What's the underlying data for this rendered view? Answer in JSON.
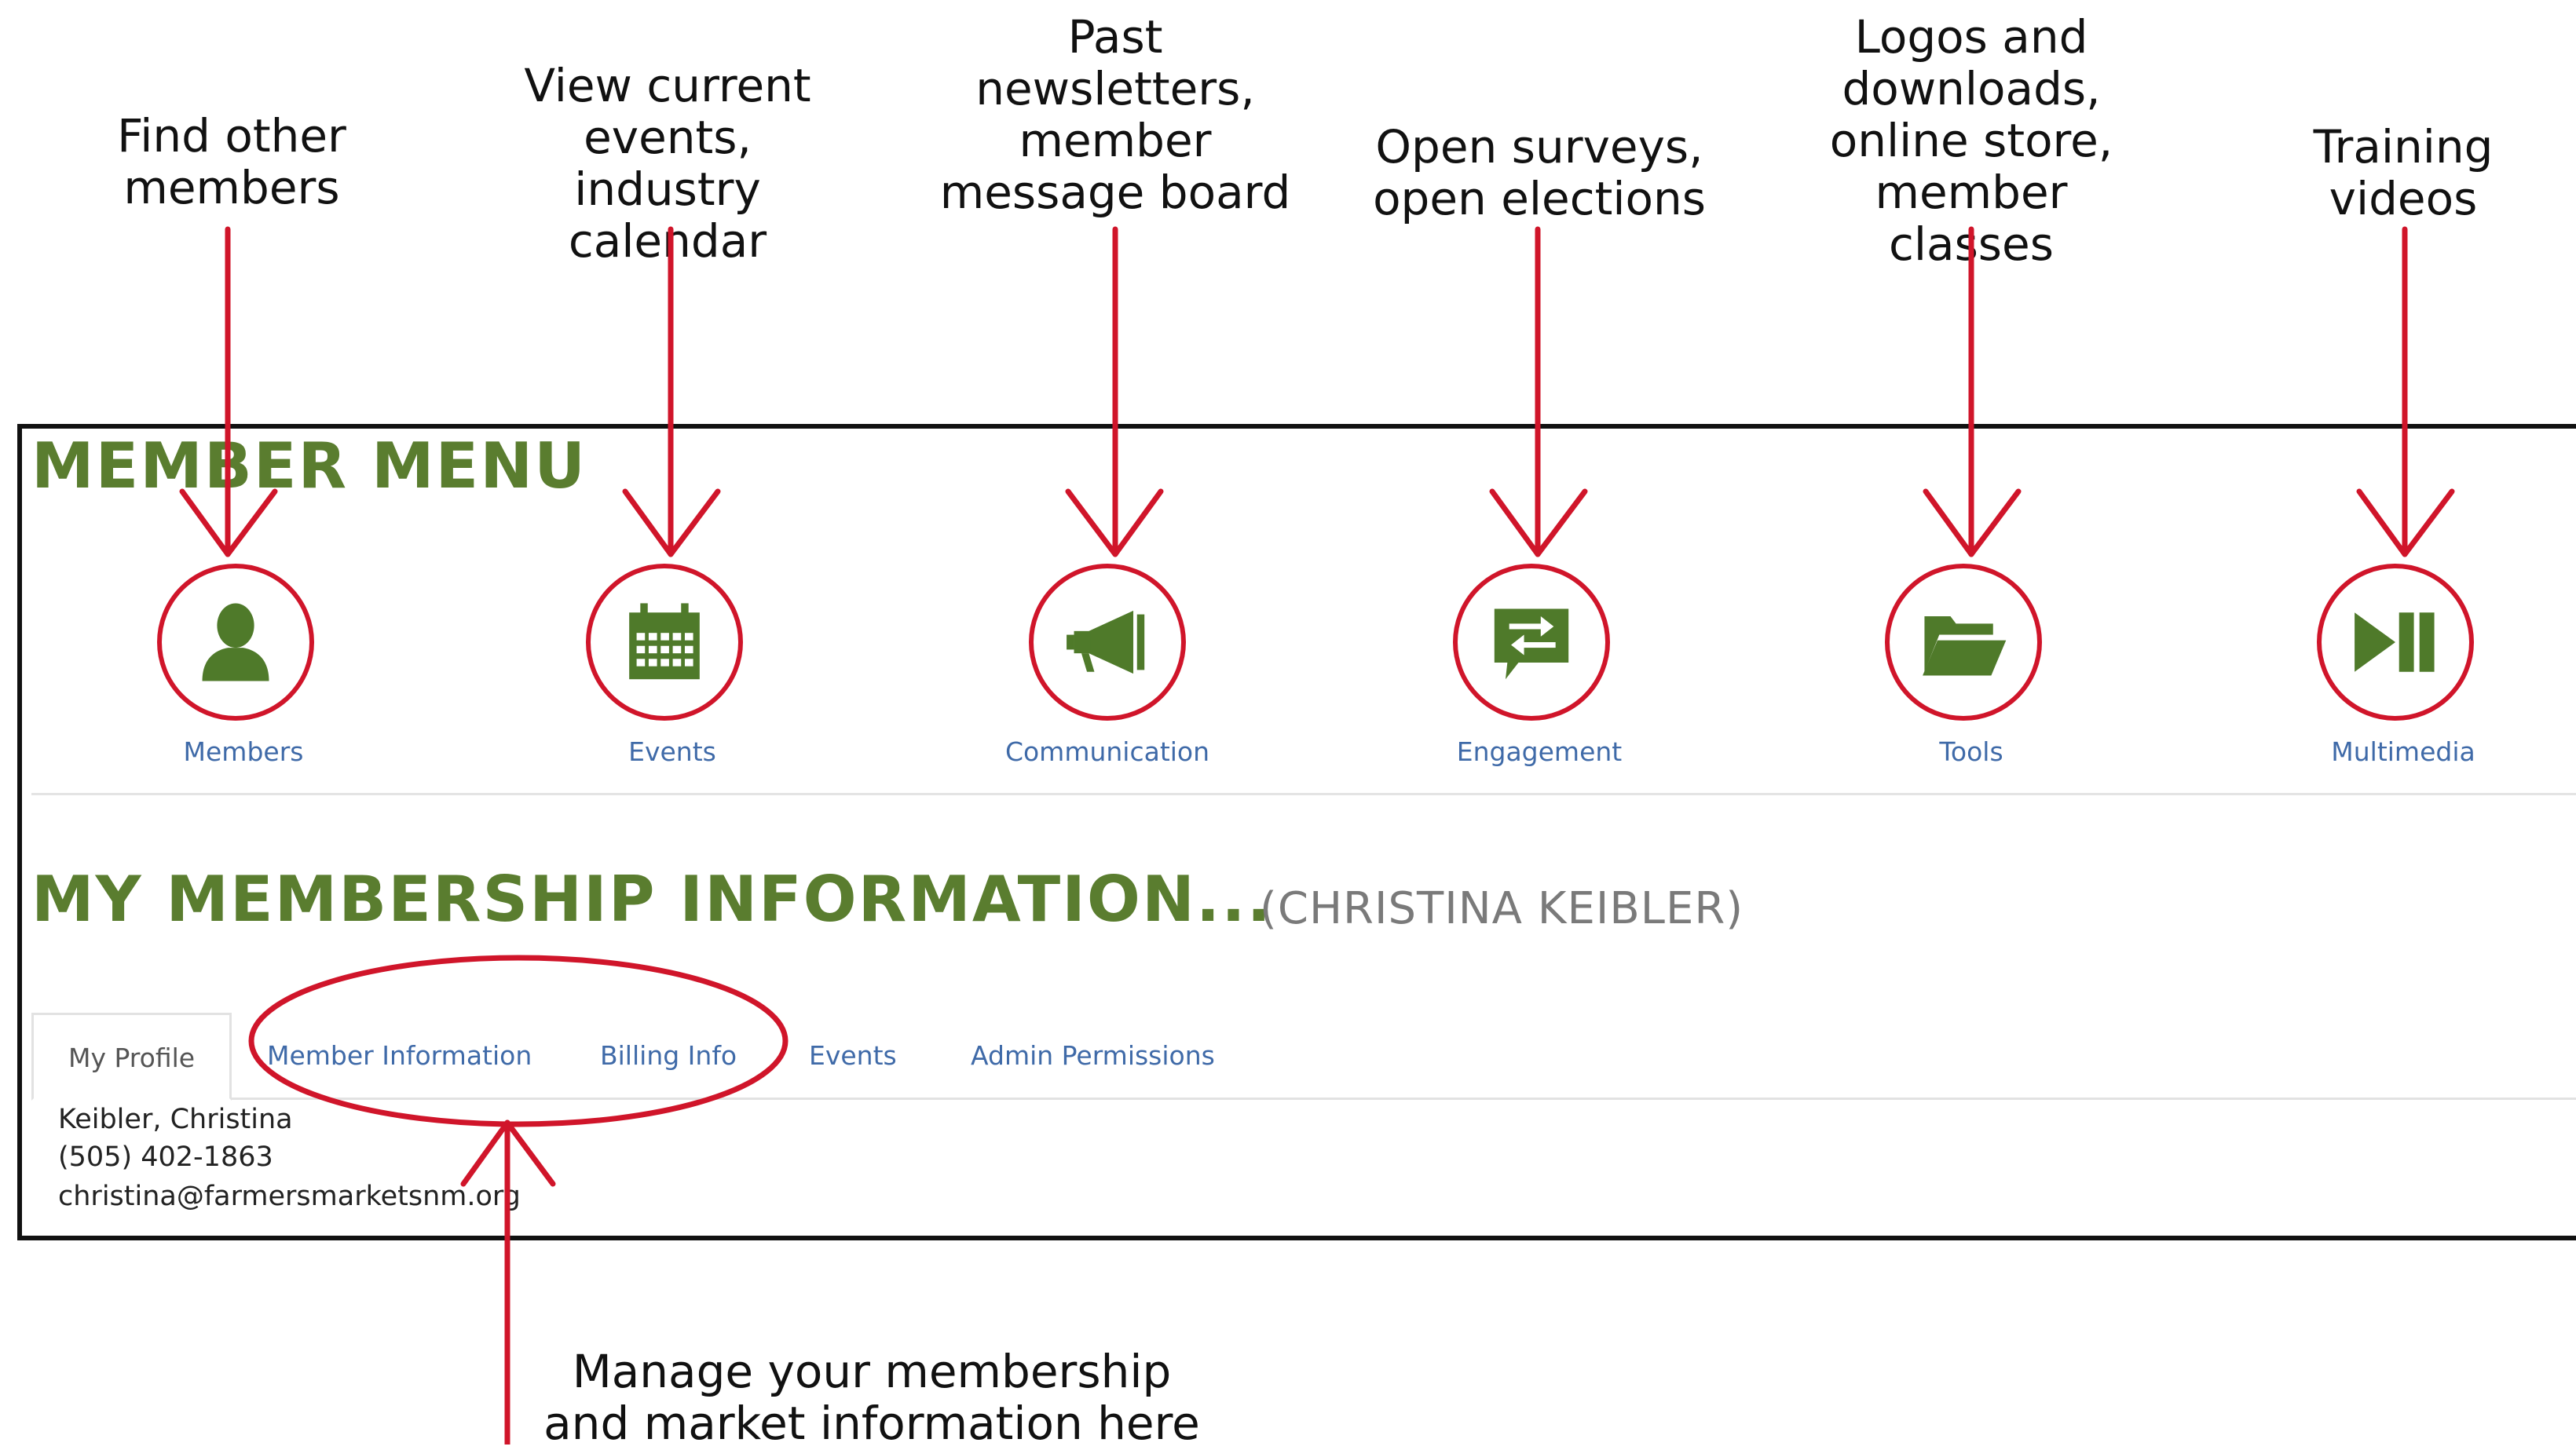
{
  "annotations": {
    "members": "Find other\nmembers",
    "events": "View current\nevents,\nindustry\ncalendar",
    "communication": "Past\nnewsletters,\nmember\nmessage board",
    "engagement": "Open surveys,\nopen elections",
    "tools": "Logos and\ndownloads,\nonline store,\nmember\nclasses",
    "multimedia": "Training\nvideos",
    "manage": "Manage your membership\nand market information  here"
  },
  "member_menu": {
    "title": "MEMBER MENU",
    "items": [
      {
        "label": "Members",
        "icon": "person-icon"
      },
      {
        "label": "Events",
        "icon": "calendar-icon"
      },
      {
        "label": "Communication",
        "icon": "megaphone-icon"
      },
      {
        "label": "Engagement",
        "icon": "exchange-chat-icon"
      },
      {
        "label": "Tools",
        "icon": "open-folder-icon"
      },
      {
        "label": "Multimedia",
        "icon": "play-pause-icon"
      }
    ]
  },
  "membership": {
    "title": "MY MEMBERSHIP INFORMATION...",
    "user": "(CHRISTINA KEIBLER)",
    "tabs": [
      "My Profile",
      "Member Information",
      "Billing Info",
      "Events",
      "Admin Permissions"
    ],
    "profile": {
      "name": "Keibler, Christina",
      "phone": "(505) 402-1863",
      "email": "christina@farmersmarketsnm.org"
    }
  },
  "colors": {
    "heading_green": "#5a7d2f",
    "icon_green": "#4f7a2a",
    "accent_red": "#d0152a",
    "link_blue": "#3f6aa8"
  }
}
